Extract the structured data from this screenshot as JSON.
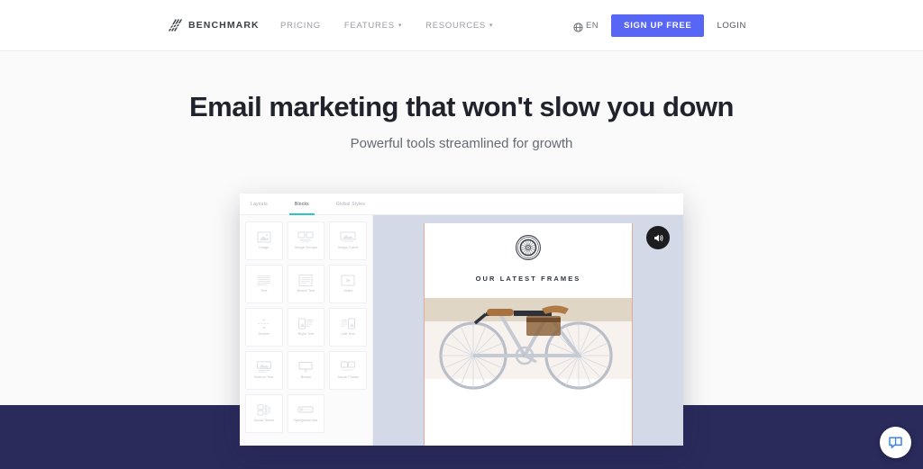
{
  "header": {
    "brand": {
      "name": "BENCHMARK",
      "logo_icon": "benchmark-slash-logo"
    },
    "nav": [
      {
        "label": "PRICING",
        "has_dropdown": false
      },
      {
        "label": "FEATURES",
        "has_dropdown": true,
        "caret": "▾"
      },
      {
        "label": "RESOURCES",
        "has_dropdown": true,
        "caret": "▾"
      }
    ],
    "language": {
      "icon": "globe-icon",
      "label": "EN"
    },
    "signup_label": "SIGN UP FREE",
    "login_label": "LOGIN",
    "accent_color": "#5766f5"
  },
  "hero": {
    "title": "Email marketing that won't slow you down",
    "subtitle": "Powerful tools streamlined for growth"
  },
  "app": {
    "tabs": [
      {
        "label": "Layouts",
        "active": false
      },
      {
        "label": "Blocks",
        "active": true
      },
      {
        "label": "Global Styles",
        "active": false
      }
    ],
    "active_tab_color": "#2ec5c5",
    "blocks": [
      {
        "label": "Image",
        "icon": "image-block-icon"
      },
      {
        "label": "Image Groups",
        "icon": "image-groups-block-icon"
      },
      {
        "label": "Image Cards",
        "icon": "image-cards-block-icon"
      },
      {
        "label": "Text",
        "icon": "text-block-icon"
      },
      {
        "label": "Boxed Text",
        "icon": "boxed-text-block-icon"
      },
      {
        "label": "Video",
        "icon": "video-block-icon"
      },
      {
        "label": "Divider",
        "icon": "divider-block-icon"
      },
      {
        "label": "Right Text",
        "icon": "right-text-block-icon"
      },
      {
        "label": "Left Text",
        "icon": "left-text-block-icon"
      },
      {
        "label": "Bottom Text",
        "icon": "bottom-text-block-icon"
      },
      {
        "label": "Button",
        "icon": "button-block-icon"
      },
      {
        "label": "Social Follow",
        "icon": "social-follow-block-icon"
      },
      {
        "label": "Social Share",
        "icon": "social-share-block-icon"
      },
      {
        "label": "Navigation Bar",
        "icon": "navigation-bar-block-icon"
      }
    ],
    "email_preview": {
      "badge_icon": "bicycle-wheel-emblem",
      "heading": "OUR LATEST FRAMES",
      "hero_image": "white-bicycle-photo",
      "canvas_color": "#d4d9e7",
      "selection_border_color": "#e8a79c"
    },
    "audio_button": {
      "icon": "volume-speaker-icon"
    }
  },
  "chat": {
    "icon": "chat-bubble-icon",
    "color": "#3b82e8"
  },
  "band": {
    "color": "#2a2b5b"
  }
}
